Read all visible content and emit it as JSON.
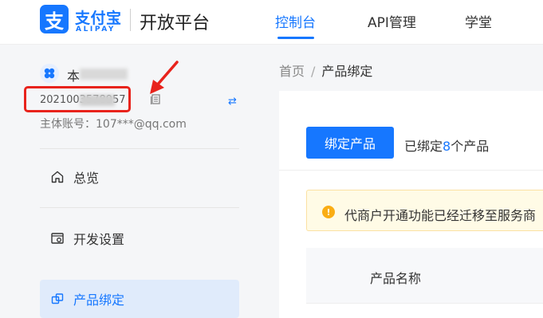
{
  "header": {
    "logo_glyph": "支",
    "brand_cn": "支付宝",
    "brand_en": "ALIPAY",
    "platform": "开放平台",
    "nav": [
      {
        "label": "控制台",
        "active": true
      },
      {
        "label": "API管理",
        "active": false
      },
      {
        "label": "学堂",
        "active": false
      }
    ],
    "accent_color": "#1677ff"
  },
  "sidebar": {
    "app_name": "本",
    "app_id": "2021003578957",
    "main_account": "主体账号：107***@qq.com",
    "menu": [
      {
        "label": "总览",
        "icon": "home-icon",
        "active": false
      },
      {
        "label": "开发设置",
        "icon": "settings-icon",
        "active": false
      },
      {
        "label": "产品绑定",
        "icon": "link-icon",
        "active": true
      }
    ]
  },
  "breadcrumb": {
    "home": "首页",
    "separator": "/",
    "current": "产品绑定"
  },
  "main": {
    "bind_button": "绑定产品",
    "bound_prefix": "已绑定",
    "bound_count": "8",
    "bound_suffix": "个产品",
    "notice": "代商户开通功能已经迁移至服务商",
    "table_header": "产品名称"
  },
  "annotation_color": "#e8231c"
}
